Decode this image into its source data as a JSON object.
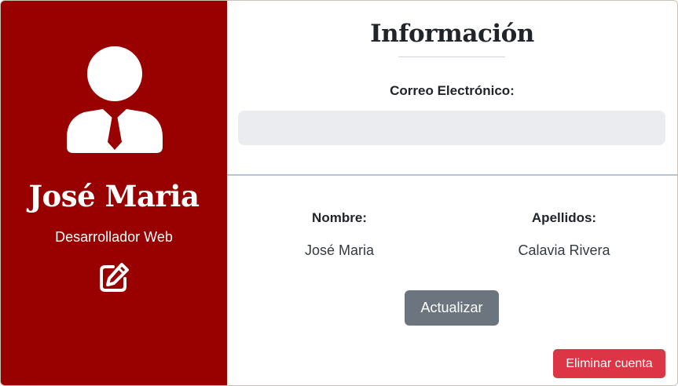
{
  "profile": {
    "name": "José Maria",
    "role": "Desarrollador Web",
    "avatar_icon": "user-tie-icon",
    "edit_icon": "edit-icon",
    "background_color": "#990000"
  },
  "info": {
    "title": "Información",
    "email_label": "Correo Electrónico:",
    "email_value": "",
    "nombre_label": "Nombre:",
    "nombre_value": "José Maria",
    "apellidos_label": "Apellidos:",
    "apellidos_value": "Calavia Rivera"
  },
  "actions": {
    "update_label": "Actualizar",
    "update_color": "#6c757d",
    "delete_label": "Eliminar cuenta",
    "delete_color": "#dc3545"
  }
}
